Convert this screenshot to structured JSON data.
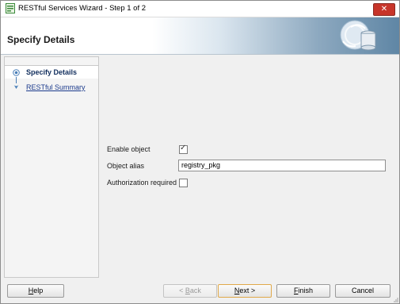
{
  "window": {
    "title": "RESTful Services Wizard - Step 1 of 2",
    "close_glyph": "✕"
  },
  "header": {
    "title": "Specify Details"
  },
  "steps": [
    {
      "label": "Specify Details",
      "active": true
    },
    {
      "label": "RESTful Summary",
      "active": false
    }
  ],
  "form": {
    "enable_object": {
      "label": "Enable object",
      "checked": true
    },
    "object_alias": {
      "label": "Object alias",
      "value": "registry_pkg"
    },
    "authorization_required": {
      "label": "Authorization required",
      "checked": false
    },
    "check_glyph": "✓"
  },
  "buttons": {
    "help": {
      "pre": "",
      "mnemonic": "H",
      "post": "elp",
      "enabled": true
    },
    "back": {
      "pre": "< ",
      "mnemonic": "B",
      "post": "ack",
      "enabled": false
    },
    "next": {
      "pre": "",
      "mnemonic": "N",
      "post": "ext >",
      "enabled": true
    },
    "finish": {
      "pre": "",
      "mnemonic": "F",
      "post": "inish",
      "enabled": true
    },
    "cancel": {
      "pre": "",
      "mnemonic": "",
      "post": "Cancel",
      "enabled": true
    }
  },
  "icons": {
    "app": "wizard-icon",
    "header": "database-sync-icon",
    "close": "close-icon",
    "step_marker": "step-circle-icon",
    "resize": "resize-grip-icon"
  },
  "colors": {
    "close_button": "#c7352a",
    "active_step_text": "#102d5c",
    "link_text": "#1b3a8c",
    "header_gradient_end": "#5f86a5"
  }
}
